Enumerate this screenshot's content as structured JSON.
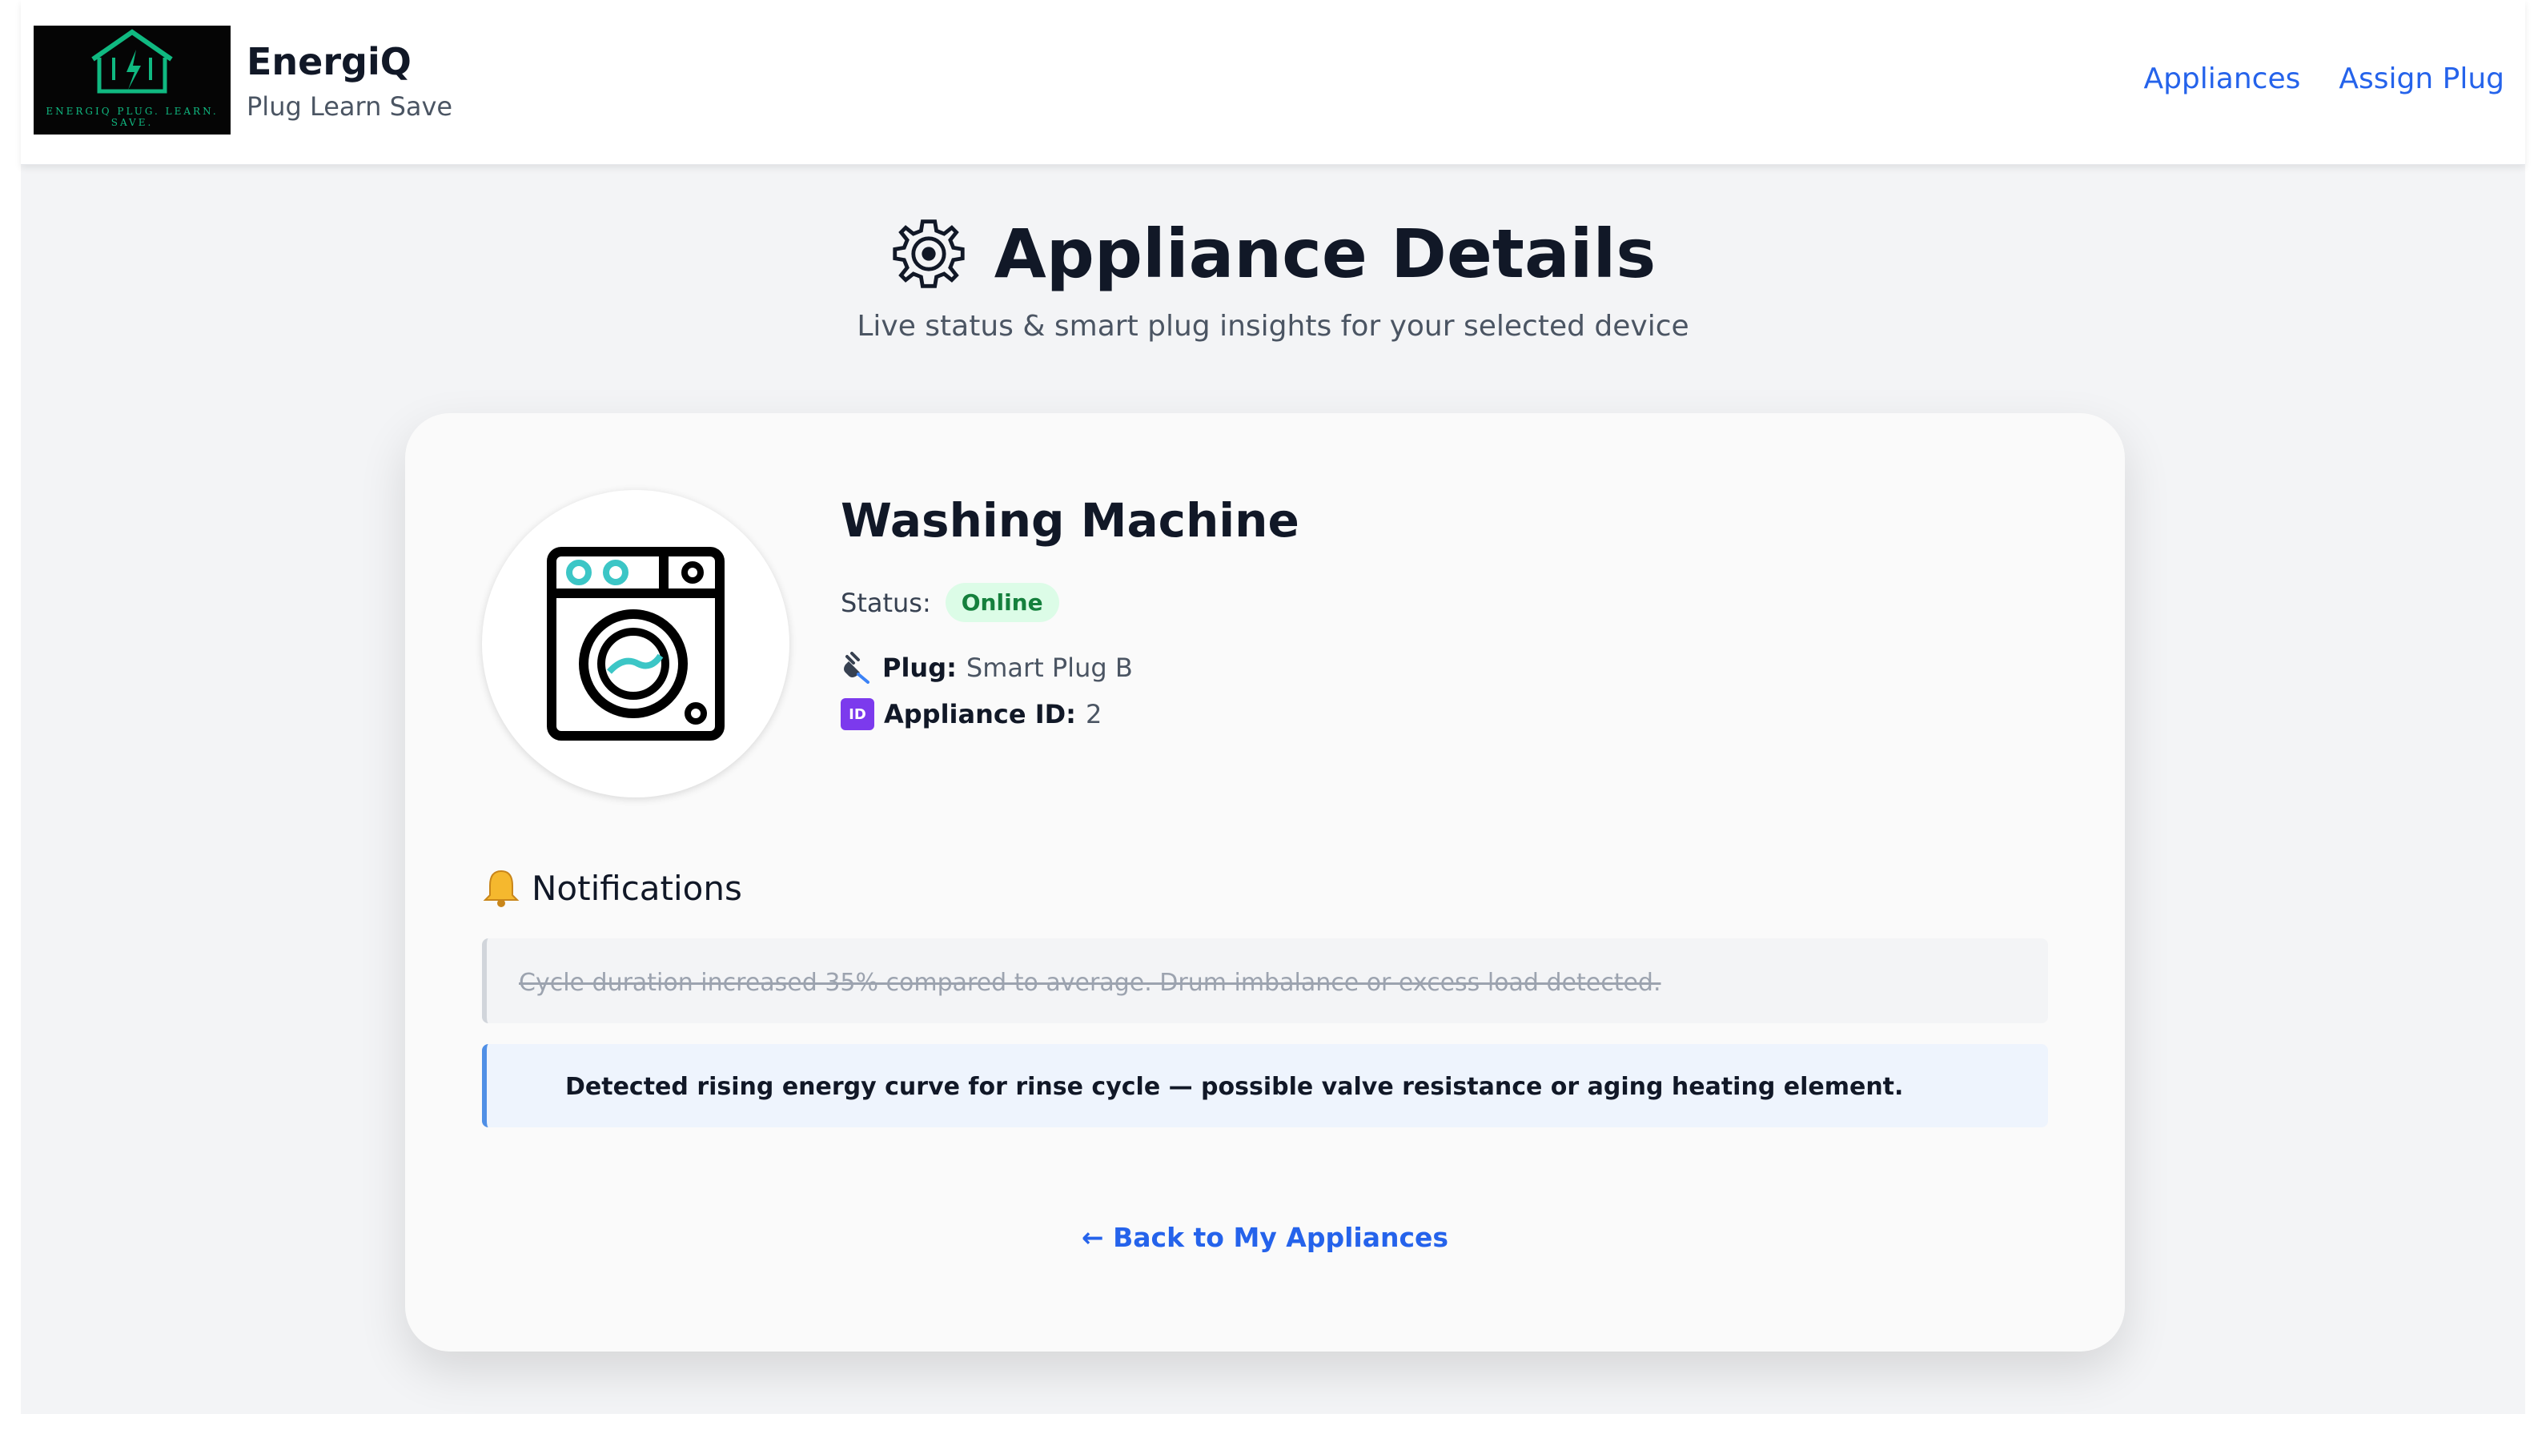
{
  "header": {
    "brand_name": "EnergiQ",
    "brand_tagline": "Plug Learn Save",
    "logo_text": "ENERGIQ PLUG. LEARN. SAVE.",
    "nav": [
      {
        "label": "Appliances"
      },
      {
        "label": "Assign Plug"
      }
    ]
  },
  "page": {
    "title": "Appliance Details",
    "subtitle": "Live status & smart plug insights for your selected device"
  },
  "appliance": {
    "name": "Washing Machine",
    "status_label": "Status:",
    "status_value": "Online",
    "plug_label": "Plug:",
    "plug_value": "Smart Plug B",
    "id_label": "Appliance ID:",
    "id_value": "2",
    "id_icon_text": "ID"
  },
  "notifications": {
    "title": "Notifications",
    "items": [
      {
        "text": "Cycle duration increased 35% compared to average. Drum imbalance or excess load detected.",
        "read": true
      },
      {
        "text": "Detected rising energy curve for rinse cycle — possible valve resistance or aging heating element.",
        "read": false
      }
    ]
  },
  "back_link": "← Back to My Appliances",
  "colors": {
    "accent": "#2563eb",
    "online_bg": "#dcfce7",
    "online_text": "#15803d",
    "washer_accent": "#3cc6c6"
  }
}
